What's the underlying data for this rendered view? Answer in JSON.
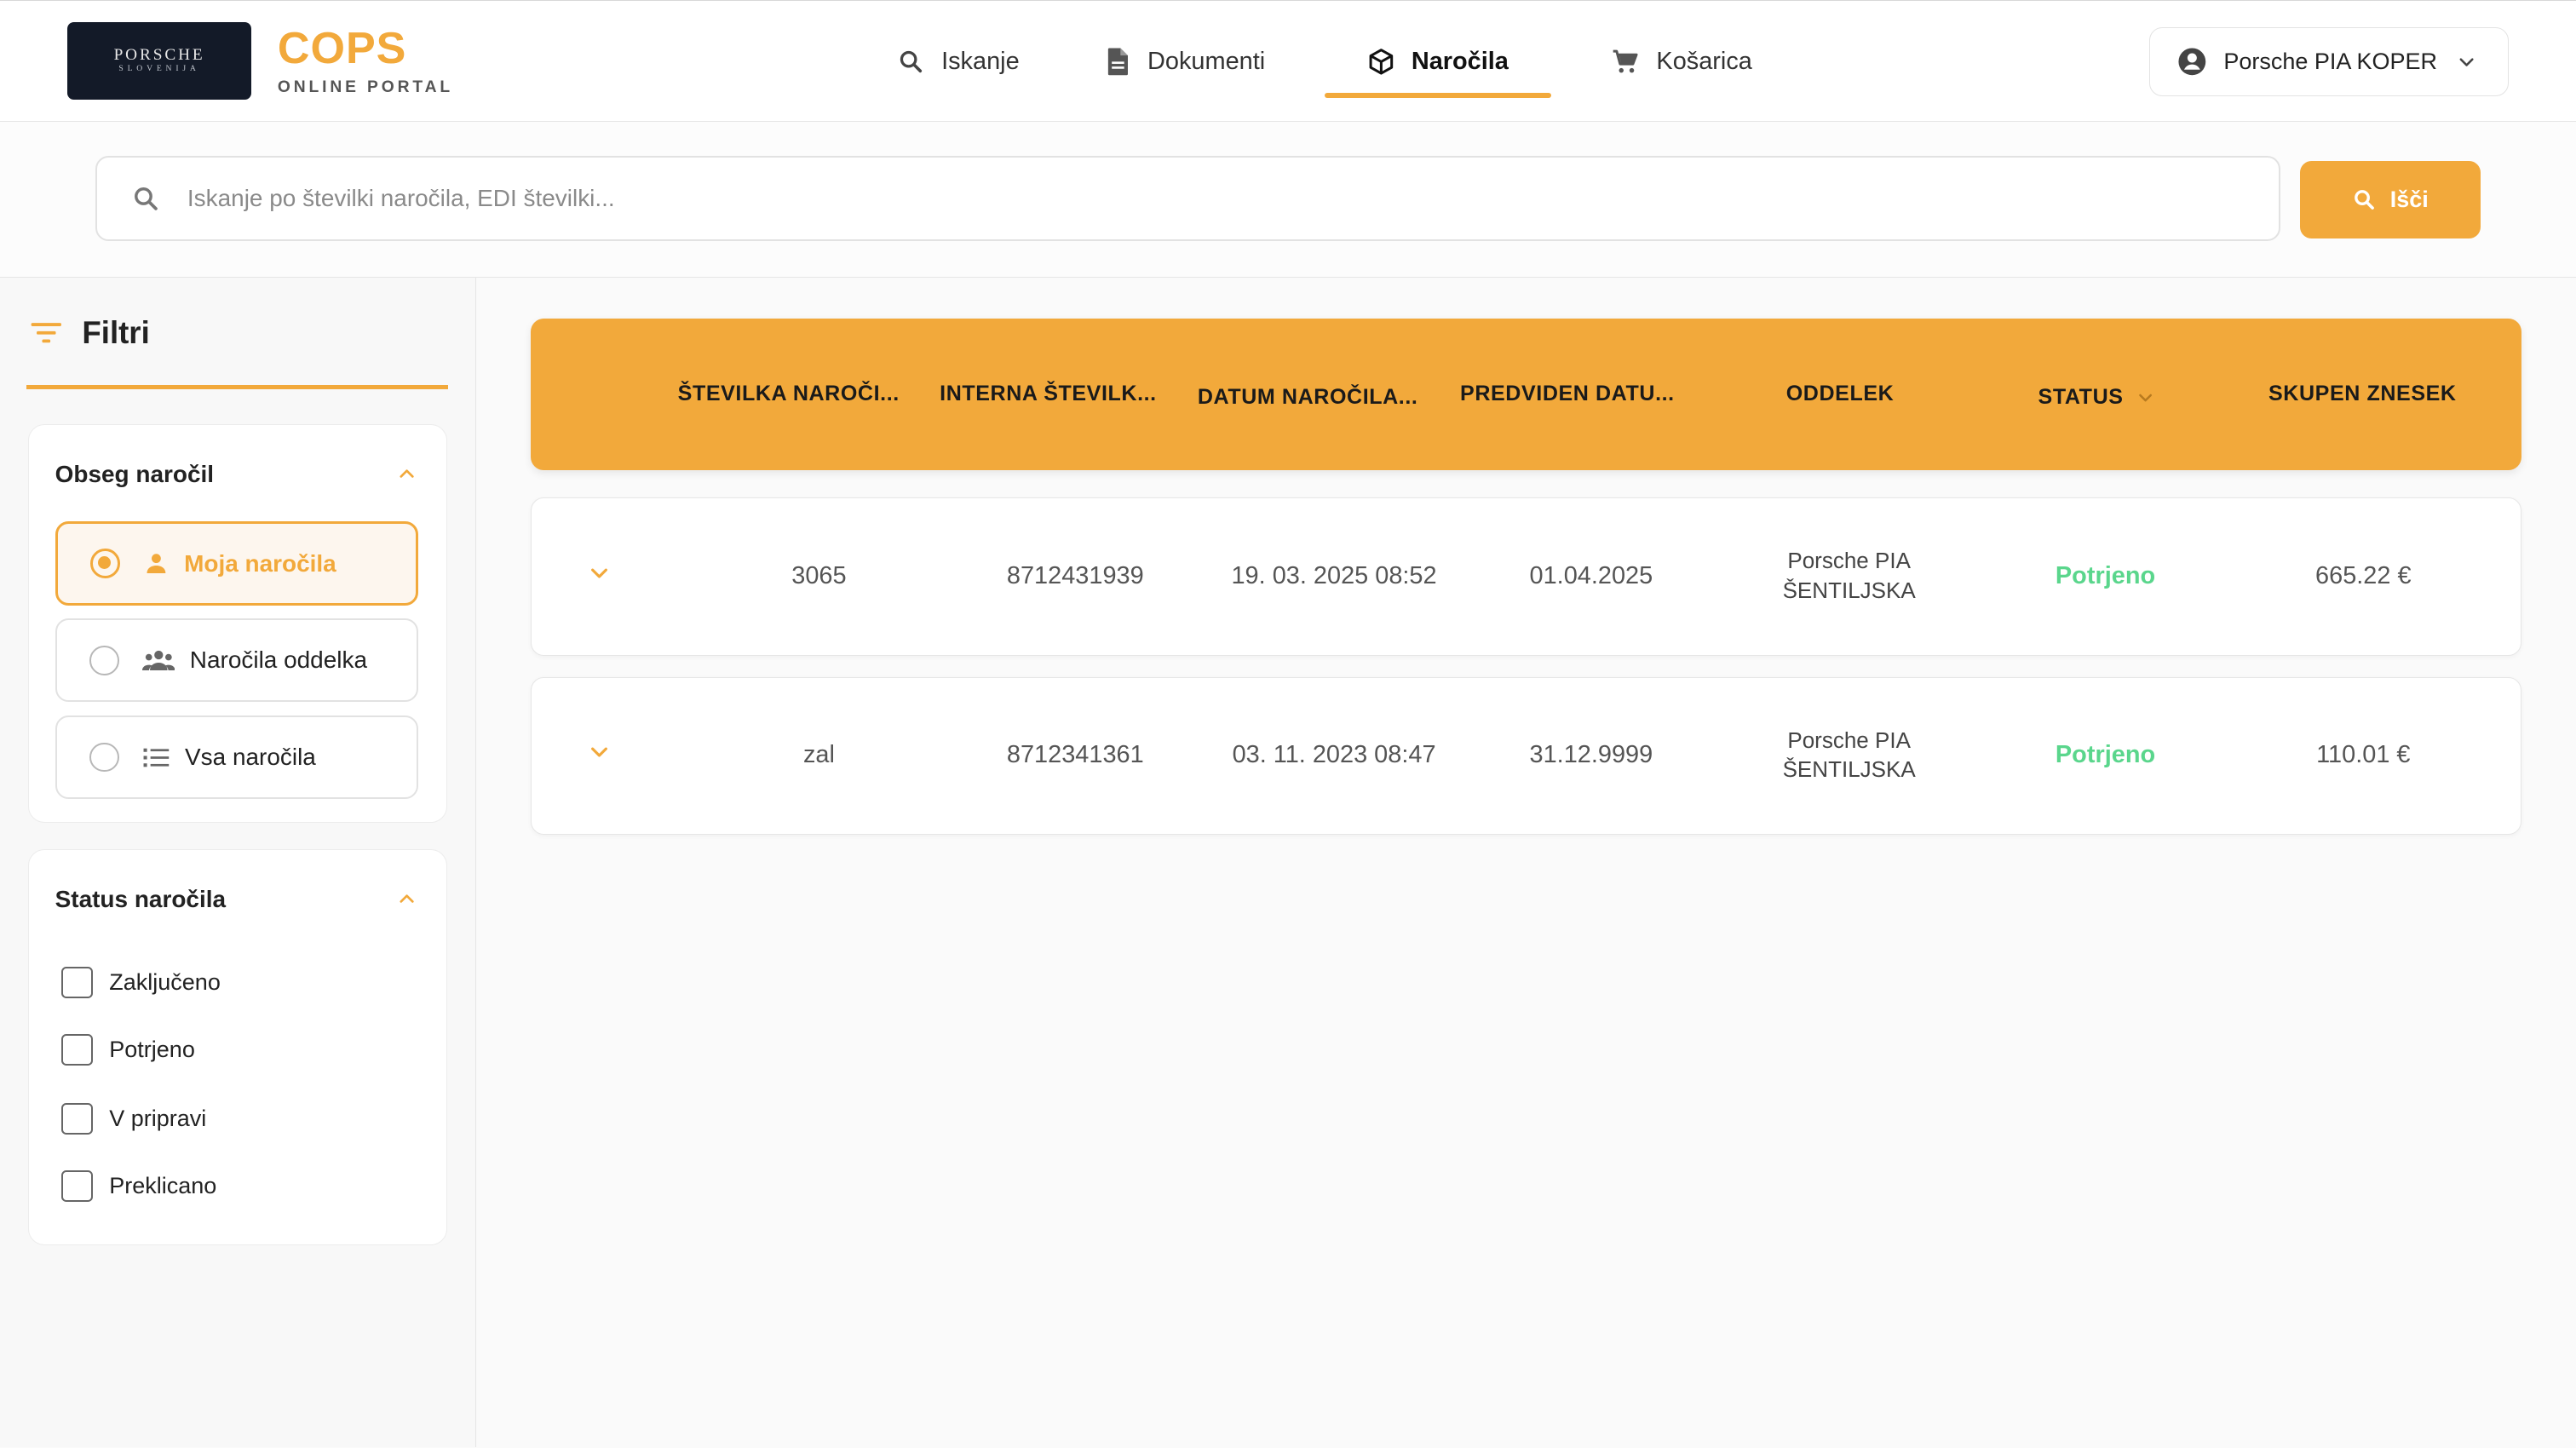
{
  "header": {
    "logo_line1": "PORSCHE",
    "logo_line2": "SLOVENIJA",
    "brand_title": "COPS",
    "brand_subtitle": "ONLINE PORTAL",
    "nav": [
      {
        "label": "Iskanje",
        "icon": "search-icon"
      },
      {
        "label": "Dokumenti",
        "icon": "document-icon"
      },
      {
        "label": "Naročila",
        "icon": "package-icon",
        "active": true
      },
      {
        "label": "Košarica",
        "icon": "cart-icon"
      }
    ],
    "account_label": "Porsche PIA KOPER"
  },
  "search": {
    "placeholder": "Iskanje po številki naročila, EDI številki...",
    "value": "",
    "button_label": "Išči"
  },
  "filters": {
    "title": "Filtri",
    "scope": {
      "title": "Obseg naročil",
      "options": [
        {
          "label": "Moja naročila",
          "icon": "person-icon",
          "selected": true
        },
        {
          "label": "Naročila oddelka",
          "icon": "group-icon",
          "selected": false
        },
        {
          "label": "Vsa naročila",
          "icon": "list-icon",
          "selected": false
        }
      ]
    },
    "status": {
      "title": "Status naročila",
      "options": [
        {
          "label": "Zaključeno",
          "checked": false
        },
        {
          "label": "Potrjeno",
          "checked": false
        },
        {
          "label": "V pripravi",
          "checked": false
        },
        {
          "label": "Preklicano",
          "checked": false
        }
      ]
    }
  },
  "table": {
    "columns": [
      "ŠTEVILKA NAROČI...",
      "INTERNA ŠTEVILK...",
      "DATUM NAROČILA...",
      "PREDVIDEN DATU...",
      "ODDELEK",
      "STATUS",
      "SKUPEN ZNESEK"
    ],
    "rows": [
      {
        "number": "3065",
        "internal": "8712431939",
        "order_date": "19. 03. 2025 08:52",
        "expected_date": "01.04.2025",
        "dept_line1": "Porsche PIA",
        "dept_line2": "ŠENTILJSKA",
        "status": "Potrjeno",
        "total": "665.22 €"
      },
      {
        "number": "zal",
        "internal": "8712341361",
        "order_date": "03. 11. 2023 08:47",
        "expected_date": "31.12.9999",
        "dept_line1": "Porsche PIA",
        "dept_line2": "ŠENTILJSKA",
        "status": "Potrjeno",
        "total": "110.01 €"
      }
    ]
  },
  "colors": {
    "accent": "#f2a93b",
    "status_confirmed": "#5ad68c",
    "logo_bg": "#131a28"
  }
}
